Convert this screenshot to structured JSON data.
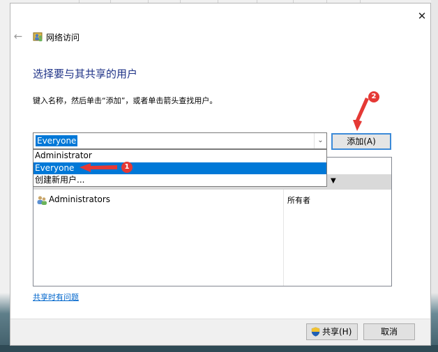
{
  "window": {
    "title": "网络访问",
    "close_symbol": "✕",
    "back_symbol": "←"
  },
  "heading": "选择要与其共享的用户",
  "instruction": "键入名称，然后单击“添加”，或者单击箭头查找用户。",
  "combo": {
    "value": "Everyone",
    "arrow": "⌄"
  },
  "add_button": "添加(A)",
  "dropdown": {
    "items": [
      {
        "label": "Administrator",
        "selected": false
      },
      {
        "label": "Everyone",
        "selected": true
      },
      {
        "label": "创建新用户...",
        "selected": false
      }
    ]
  },
  "table": {
    "header_arrow": "▼",
    "rows": [
      {
        "name": "Administrators",
        "permission": "所有者"
      }
    ]
  },
  "help_link": "共享时有问题",
  "footer": {
    "share_button": "共享(H)",
    "cancel_button": "取消"
  },
  "annotations": [
    {
      "label": "1"
    },
    {
      "label": "2"
    }
  ],
  "colors": {
    "accent": "#0078d7",
    "heading": "#1e3287",
    "link": "#0066cc",
    "annotation": "#e53935"
  },
  "icons": {
    "title": "network-users-icon",
    "row": "users-group-icon",
    "share": "uac-shield-icon"
  }
}
